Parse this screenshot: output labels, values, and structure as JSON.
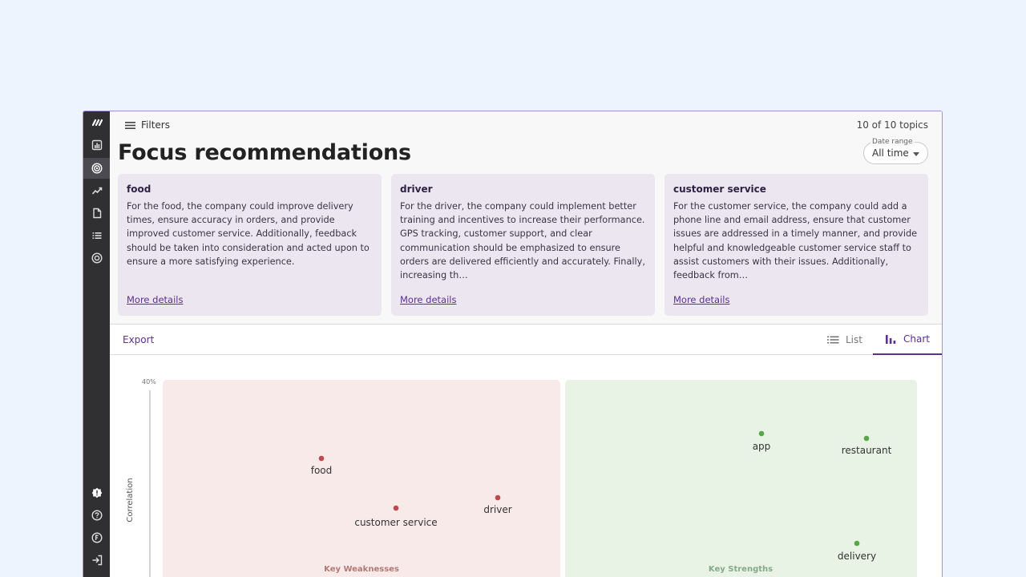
{
  "header": {
    "filters_label": "Filters",
    "topic_count": "10 of 10 topics",
    "title": "Focus recommendations",
    "date_range": {
      "label": "Date range",
      "value": "All time"
    }
  },
  "sidebar": {
    "items": [
      {
        "icon": "logo-icon"
      },
      {
        "icon": "bar-chart-icon"
      },
      {
        "icon": "target-icon",
        "active": true
      },
      {
        "icon": "trend-icon"
      },
      {
        "icon": "document-icon"
      },
      {
        "icon": "list-icon"
      },
      {
        "icon": "circle-icon"
      },
      {
        "icon": "alert-icon"
      },
      {
        "icon": "help-icon"
      },
      {
        "icon": "feedback-icon"
      },
      {
        "icon": "logout-icon"
      }
    ]
  },
  "cards": [
    {
      "title": "food",
      "body": "For the food, the company could improve delivery times, ensure accuracy in orders, and provide improved customer service. Additionally, feedback should be taken into consideration and acted upon to ensure a more satisfying experience.",
      "link": "More details"
    },
    {
      "title": "driver",
      "body": "For the driver, the company could implement better training and incentives to increase their performance. GPS tracking, customer support, and clear communication should be emphasized to ensure orders are delivered efficiently and accurately. Finally, increasing th…",
      "link": "More details"
    },
    {
      "title": "customer service",
      "body": "For the customer service, the company could add a phone line and email address, ensure that customer issues are addressed in a timely manner, and provide helpful and knowledgeable customer service staff to assist customers with their issues. Additionally, feedback from…",
      "link": "More details"
    }
  ],
  "toolbar": {
    "export_label": "Export",
    "list_label": "List",
    "chart_label": "Chart"
  },
  "chart_data": {
    "type": "scatter",
    "ylabel": "Correlation",
    "ytick_top": "40%",
    "zones": [
      {
        "name": "Key Weaknesses",
        "color": "#f8eae9"
      },
      {
        "name": "Key Strengths",
        "color": "#e8f3e5"
      }
    ],
    "colors": {
      "weakness": "#c0474a",
      "strength": "#55a844"
    },
    "points": [
      {
        "label": "food",
        "zone": "weakness"
      },
      {
        "label": "customer service",
        "zone": "weakness"
      },
      {
        "label": "driver",
        "zone": "weakness"
      },
      {
        "label": "app",
        "zone": "strength"
      },
      {
        "label": "restaurant",
        "zone": "strength"
      },
      {
        "label": "delivery",
        "zone": "strength"
      }
    ]
  }
}
